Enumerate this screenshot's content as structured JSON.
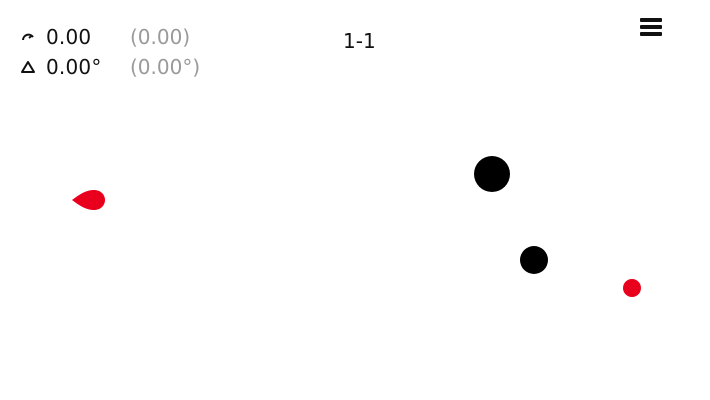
{
  "hud": {
    "speed": {
      "icon": "gauge-icon",
      "value": "0.00",
      "best": "(0.00)"
    },
    "angle": {
      "icon": "angle-icon",
      "value": "0.00°",
      "best": "(0.00°)"
    }
  },
  "level": "1-1",
  "menu": {
    "icon": "hamburger-menu-icon"
  },
  "colors": {
    "ball": "#e8001c",
    "obstacle": "#000000",
    "target": "#e8001c",
    "text": "#111111",
    "muted_text": "#9a9a9a",
    "background": "#ffffff"
  }
}
